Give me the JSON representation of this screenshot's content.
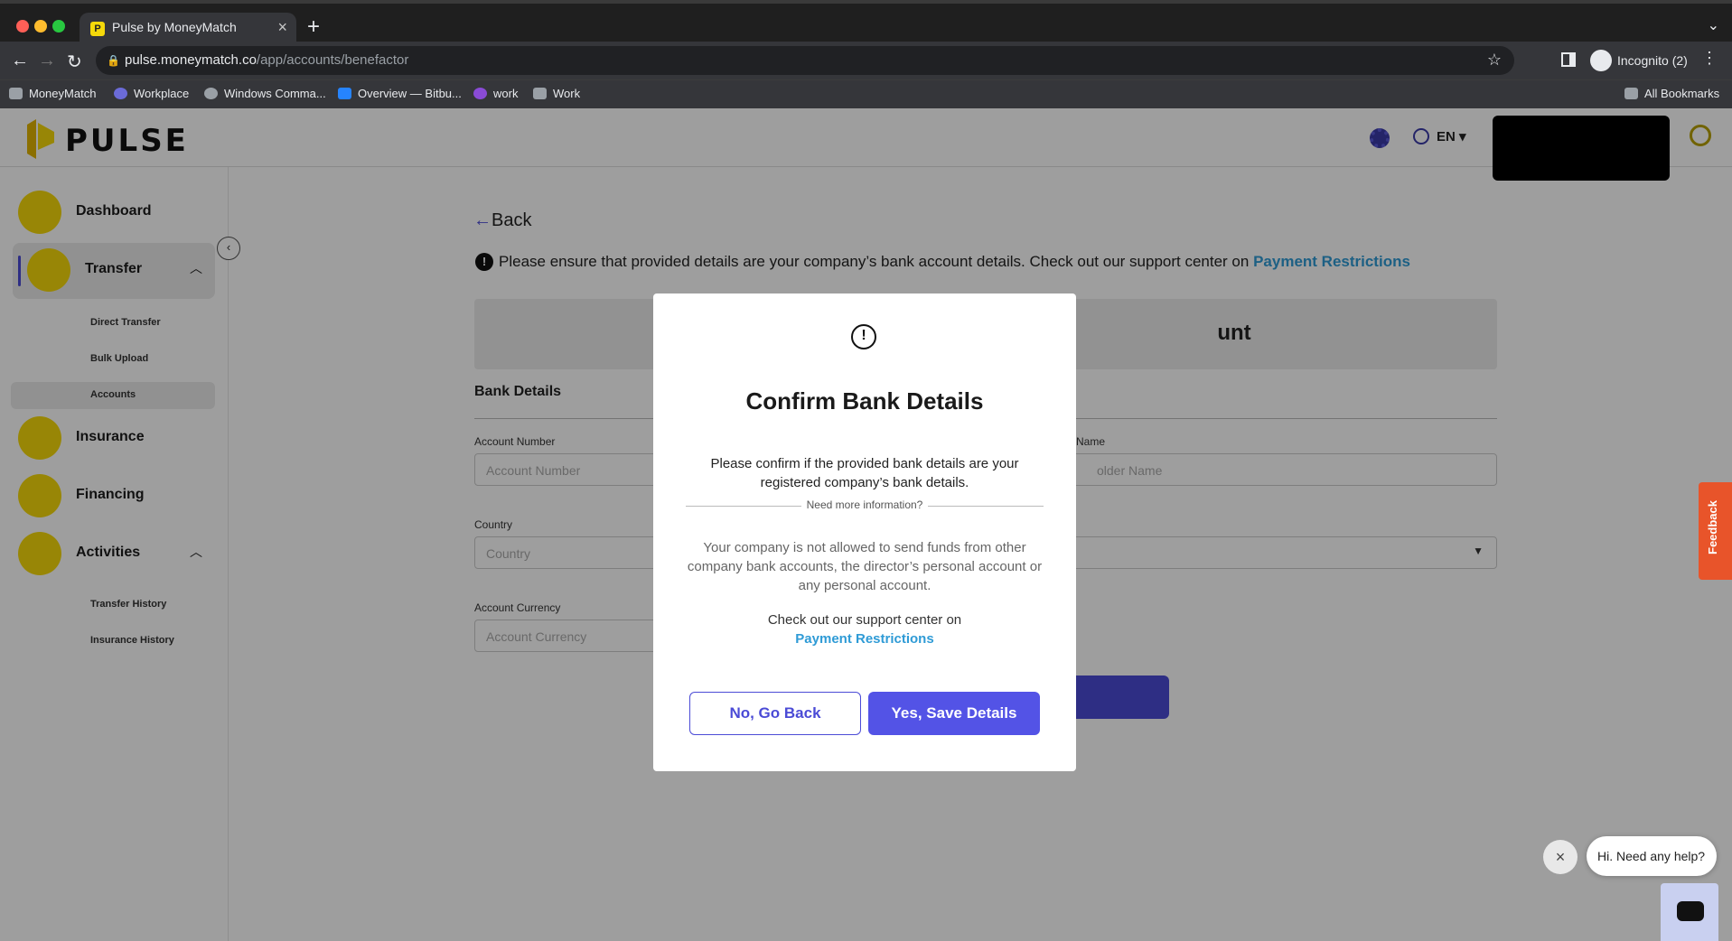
{
  "browser": {
    "tab_title": "Pulse by MoneyMatch",
    "tab_favicon": "P",
    "url_host": "pulse.moneymatch.co",
    "url_path": "/app/accounts/benefactor",
    "profile_label": "Incognito (2)",
    "bookmarks": [
      {
        "label": "MoneyMatch",
        "icon": "folder-icon"
      },
      {
        "label": "Workplace",
        "icon": "workplace-icon"
      },
      {
        "label": "Windows Comma...",
        "icon": "globe-icon"
      },
      {
        "label": "Overview — Bitbu...",
        "icon": "bitbucket-icon"
      },
      {
        "label": "work",
        "icon": "work-icon"
      },
      {
        "label": "Work",
        "icon": "folder-icon"
      }
    ],
    "all_bookmarks_label": "All Bookmarks"
  },
  "header": {
    "logo_text": "PULSE",
    "language": "EN"
  },
  "sidebar": {
    "items": [
      {
        "label": "Dashboard",
        "icon": "dashboard-icon"
      },
      {
        "label": "Transfer",
        "icon": "bank-icon"
      },
      {
        "label": "Insurance",
        "icon": "insurance-icon"
      },
      {
        "label": "Financing",
        "icon": "financing-icon"
      },
      {
        "label": "Activities",
        "icon": "activities-icon"
      }
    ],
    "transfer_sub": [
      "Direct Transfer",
      "Bulk Upload",
      "Accounts"
    ],
    "activities_sub": [
      "Transfer History",
      "Insurance History"
    ]
  },
  "page": {
    "back_label": "Back",
    "notice_text": "Please ensure that provided details are your company’s bank account details. Check out our support center on ",
    "notice_link": "Payment Restrictions",
    "card_title_visible": "unt",
    "section_title": "Bank Details",
    "fields": {
      "account_number_label": "Account Number",
      "account_number_placeholder": "Account Number",
      "holder_name_label": "Name",
      "holder_name_placeholder": "older Name",
      "country_label": "Country",
      "country_placeholder": "Country",
      "account_currency_label": "Account Currency",
      "account_currency_placeholder": "Account Currency"
    }
  },
  "modal": {
    "title": "Confirm Bank Details",
    "body": "Please confirm if the provided bank details are your registered company’s bank details.",
    "divider_label": "Need more information?",
    "info": "Your company is not allowed to send funds from other company bank accounts, the director’s personal account or any personal account.",
    "support_text": "Check out our support center on",
    "support_link": "Payment Restrictions",
    "cancel_label": "No, Go Back",
    "confirm_label": "Yes, Save Details"
  },
  "widgets": {
    "feedback_label": "Feedback",
    "chat_prompt": "Hi. Need any help?"
  },
  "colors": {
    "accent": "#5353e6",
    "brand_yellow": "#f5d90a",
    "link": "#2f9bd6",
    "feedback": "#e8542a"
  }
}
